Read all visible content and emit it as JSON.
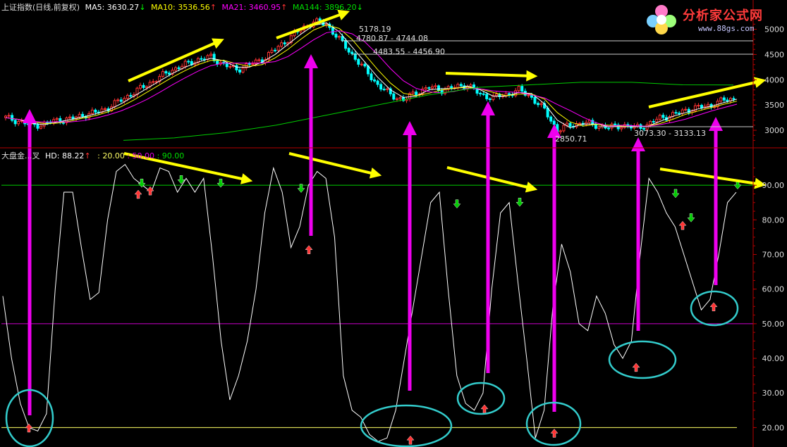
{
  "header": {
    "title": "上证指数(日线,前复权)",
    "ma5": "MA5: 3630.27",
    "ma5_arrow": "↓",
    "ma10": "MA10: 3536.56",
    "ma10_arrow": "↑",
    "ma21": "MA21: 3460.95",
    "ma21_arrow": "↑",
    "ma144": "MA144: 3896.20",
    "ma144_arrow": "↓"
  },
  "indicator_header": {
    "name": "大盘金...叉",
    "hd": "HD: 88.22",
    "hd_arrow": "↑",
    "v1": ": 20.00",
    "v2": ": 50.00",
    "v3": ": 90.00"
  },
  "logo": {
    "title": "分析家公式网",
    "url": "www.88gs.com"
  },
  "colors": {
    "background": "#000000",
    "axis": "#b30000",
    "ma5": "#ffffff",
    "ma10": "#ffff00",
    "ma21": "#ff00ff",
    "ma144": "#00cc00",
    "candle_up": "#ff3333",
    "candle_down": "#00ffff",
    "arrow_yellow": "#ffff00",
    "arrow_magenta": "#ee00ee",
    "circle": "#33cccc",
    "line_90": "#00cc00",
    "line_50": "#cc00cc",
    "line_20": "#ffff66",
    "buy_arrow": "#ff3333",
    "sell_arrow": "#00cc00"
  },
  "chart_data": [
    {
      "type": "candlestick",
      "title": "上证指数(日线,前复权)",
      "ylim": [
        2750,
        5300
      ],
      "yticks": [
        3000,
        3500,
        4000,
        4500,
        5000
      ],
      "series": [
        {
          "name": "close",
          "values": [
            3250,
            3180,
            3100,
            3120,
            3200,
            3220,
            3300,
            3350,
            3450,
            3600,
            3750,
            3900,
            4050,
            4200,
            4300,
            4400,
            4450,
            4300,
            4200,
            4300,
            4400,
            4600,
            4800,
            5000,
            5150,
            5100,
            4800,
            4500,
            4200,
            3900,
            3700,
            3600,
            3750,
            3850,
            3800,
            3850,
            3900,
            3700,
            3650,
            3700,
            3800,
            3650,
            3400,
            3000,
            3100,
            3150,
            3100,
            3050,
            3100,
            3050,
            3100,
            3250,
            3300,
            3400,
            3450,
            3500,
            3600,
            3630
          ]
        },
        {
          "name": "MA144",
          "values": [
            2800,
            2850,
            2950,
            3100,
            3300,
            3500,
            3700,
            3850,
            3900,
            3950,
            3950,
            3900,
            3896
          ]
        }
      ],
      "annotations": [
        "5178.19",
        "4780.87 - 4744.08",
        "4483.55 - 4456.90",
        "2850.71",
        "3073.30 - 3133.13"
      ]
    },
    {
      "type": "line",
      "title": "大盘金...叉",
      "ylim": [
        15,
        100
      ],
      "yticks": [
        20,
        30,
        40,
        50,
        60,
        70,
        80,
        90
      ],
      "hlines": [
        20,
        50,
        90
      ],
      "series": [
        {
          "name": "HD",
          "values": [
            58,
            40,
            27,
            20,
            19,
            24,
            60,
            88,
            88,
            72,
            57,
            59,
            80,
            94,
            96,
            92,
            90,
            88,
            95,
            94,
            88,
            92,
            88,
            92,
            70,
            45,
            28,
            35,
            45,
            60,
            82,
            95,
            88,
            72,
            78,
            90,
            94,
            92,
            75,
            35,
            25,
            23,
            18,
            16,
            17,
            25,
            40,
            55,
            70,
            85,
            88,
            60,
            35,
            27,
            25,
            30,
            60,
            82,
            85,
            62,
            40,
            17,
            25,
            55,
            73,
            65,
            50,
            48,
            58,
            53,
            44,
            40,
            45,
            70,
            92,
            88,
            82,
            78,
            70,
            62,
            54,
            57,
            70,
            85,
            88
          ]
        }
      ],
      "buy_arrows": [
        20.5,
        88,
        89,
        72,
        17,
        26,
        19,
        38,
        79,
        55.5
      ],
      "sell_arrows": [
        90,
        91,
        90,
        88.5,
        84,
        84.5,
        87,
        80,
        89.5
      ],
      "last_value": 88.22
    }
  ]
}
